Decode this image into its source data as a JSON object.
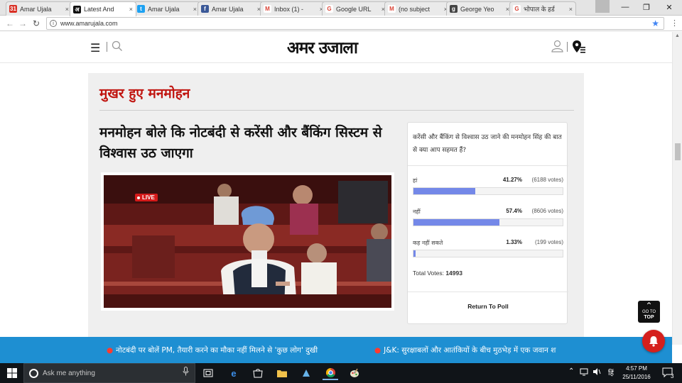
{
  "browser": {
    "tabs": [
      {
        "title": "Amar Ujala",
        "favicon": "calendar-icon",
        "fav_color": "#d93025",
        "fav_glyph": "31",
        "active": false
      },
      {
        "title": "Latest And",
        "favicon": "amar-ujala-icon",
        "fav_color": "#111111",
        "fav_glyph": "अ",
        "active": true
      },
      {
        "title": "Amar Ujala",
        "favicon": "twitter-icon",
        "fav_color": "#1da1f2",
        "fav_glyph": "t",
        "active": false
      },
      {
        "title": "Amar Ujala",
        "favicon": "facebook-icon",
        "fav_color": "#3b5998",
        "fav_glyph": "f",
        "active": false
      },
      {
        "title": "Inbox (1) -",
        "favicon": "gmail-icon",
        "fav_color": "#ffffff",
        "fav_glyph": "M",
        "active": false
      },
      {
        "title": "Google URL",
        "favicon": "google-icon",
        "fav_color": "#ffffff",
        "fav_glyph": "G",
        "active": false
      },
      {
        "title": "(no subject",
        "favicon": "gmail-icon",
        "fav_color": "#ffffff",
        "fav_glyph": "M",
        "active": false
      },
      {
        "title": "George Yeo",
        "favicon": "bookmark-icon",
        "fav_color": "#444444",
        "fav_glyph": "g",
        "active": false
      },
      {
        "title": "भोपाल के हर्ड",
        "favicon": "google-icon",
        "fav_color": "#ffffff",
        "fav_glyph": "G",
        "active": false
      }
    ],
    "url": "www.amarujala.com"
  },
  "site": {
    "logo": "अमर उजाला"
  },
  "section": {
    "title": "मुखर हुए मनमोहन",
    "headline": "मनमोहन बोले कि नोटबंदी से करेंसी और बैंकिंग सिस्टम से विश्वास उठ जाएगा",
    "live_label": "LIVE"
  },
  "poll": {
    "question": "करेंसी और बैंकिंग से विश्वास उठ जाने की मनमोहन सिंह की बात से क्या आप सहमत हैं?",
    "options": [
      {
        "label": "हां",
        "percent": "41.27%",
        "votes": "(6188 votes)",
        "share": 0.4127
      },
      {
        "label": "नहीं",
        "percent": "57.4%",
        "votes": "(8606 votes)",
        "share": 0.574
      },
      {
        "label": "कह नहीं सकते",
        "percent": "1.33%",
        "votes": "(199 votes)",
        "share": 0.0133
      }
    ],
    "total_label": "Total Votes:",
    "total_value": "14993",
    "return_label": "Return To Poll",
    "bar_color": "#7488e8"
  },
  "gotop": {
    "line1": "GO TO",
    "line2": "TOP"
  },
  "ticker": {
    "items": [
      "नोटबंदी पर बोलें PM, तैयारी करने का मौका नहीं मिलने से 'कुछ लोग' दुखी",
      "J&K: सुरक्षाबलों और आतंकियों के बीच मुठभेड़ में एक जवान श"
    ],
    "bg_color": "#1e8fd2"
  },
  "taskbar": {
    "search_placeholder": "Ask me anything",
    "language": "हिं",
    "time": "4:57 PM",
    "date": "25/11/2016",
    "notifications": "3"
  }
}
